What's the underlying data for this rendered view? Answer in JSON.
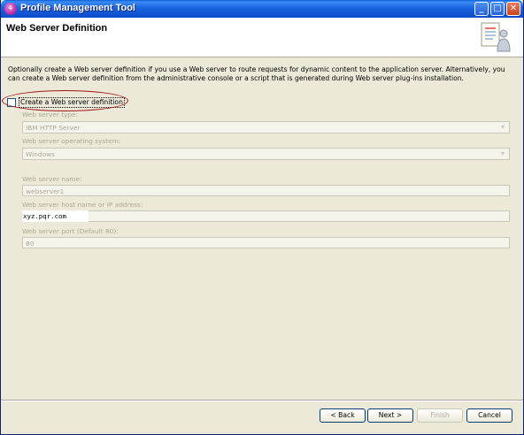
{
  "window": {
    "title": "Profile Management Tool",
    "app_icon_glyph": "⚘"
  },
  "header": {
    "title": "Web Server Definition",
    "icon": "wizard-document-person-icon"
  },
  "description": "Optionally create a Web server definition if you use a Web server to route requests for dynamic content to the application server. Alternatively, you can create a Web server definition from the administrative console or a script that is generated during Web server plug-ins installation.",
  "create_checkbox": {
    "label": "Create a Web server definition",
    "checked": false
  },
  "form": {
    "server_type_label": "Web server type:",
    "server_type_value": "IBM HTTP Server",
    "os_label": "Web server operating system:",
    "os_value": "Windows",
    "name_label": "Web server name:",
    "name_value": "webserver1",
    "host_label": "Web server host name or IP address:",
    "host_value": "xyz.pqr.com",
    "port_label": "Web server port (Default 80):",
    "port_value": "80"
  },
  "buttons": {
    "back": "< Back",
    "next": "Next >",
    "finish": "Finish",
    "cancel": "Cancel"
  },
  "colors": {
    "titlebar": "#0a4cc9",
    "dialog_bg": "#ece9d8",
    "disabled_text": "#aca899",
    "annotation_ellipse": "#a31515"
  }
}
